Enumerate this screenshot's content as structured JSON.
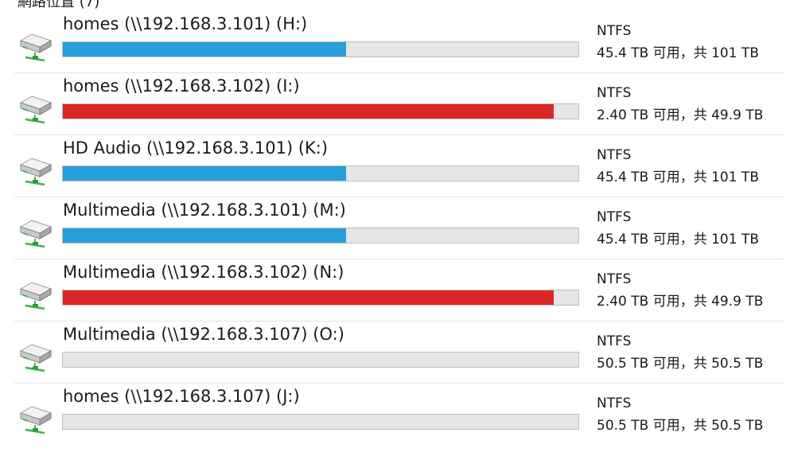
{
  "header_partial": "網路位置 (7)",
  "drives": [
    {
      "name": "homes (\\\\192.168.3.101) (H:)",
      "fs": "NTFS",
      "space": "45.4 TB 可用，共 101 TB",
      "used_fraction": 0.55,
      "bar_color": "#26a0da",
      "icon": "network-drive-icon"
    },
    {
      "name": "homes (\\\\192.168.3.102) (I:)",
      "fs": "NTFS",
      "space": "2.40 TB 可用，共 49.9 TB",
      "used_fraction": 0.952,
      "bar_color": "#da2626",
      "icon": "network-drive-icon"
    },
    {
      "name": "HD Audio (\\\\192.168.3.101) (K:)",
      "fs": "NTFS",
      "space": "45.4 TB 可用，共 101 TB",
      "used_fraction": 0.55,
      "bar_color": "#26a0da",
      "icon": "network-drive-icon"
    },
    {
      "name": "Multimedia (\\\\192.168.3.101) (M:)",
      "fs": "NTFS",
      "space": "45.4 TB 可用，共 101 TB",
      "used_fraction": 0.55,
      "bar_color": "#26a0da",
      "icon": "network-drive-icon"
    },
    {
      "name": "Multimedia (\\\\192.168.3.102) (N:)",
      "fs": "NTFS",
      "space": "2.40 TB 可用，共 49.9 TB",
      "used_fraction": 0.952,
      "bar_color": "#da2626",
      "icon": "network-drive-icon"
    },
    {
      "name": "Multimedia (\\\\192.168.3.107) (O:)",
      "fs": "NTFS",
      "space": "50.5 TB 可用，共 50.5 TB",
      "used_fraction": 0.0,
      "bar_color": "#26a0da",
      "icon": "network-drive-icon"
    },
    {
      "name": "homes (\\\\192.168.3.107) (J:)",
      "fs": "NTFS",
      "space": "50.5 TB 可用，共 50.5 TB",
      "used_fraction": 0.0,
      "bar_color": "#26a0da",
      "icon": "network-drive-icon"
    }
  ]
}
